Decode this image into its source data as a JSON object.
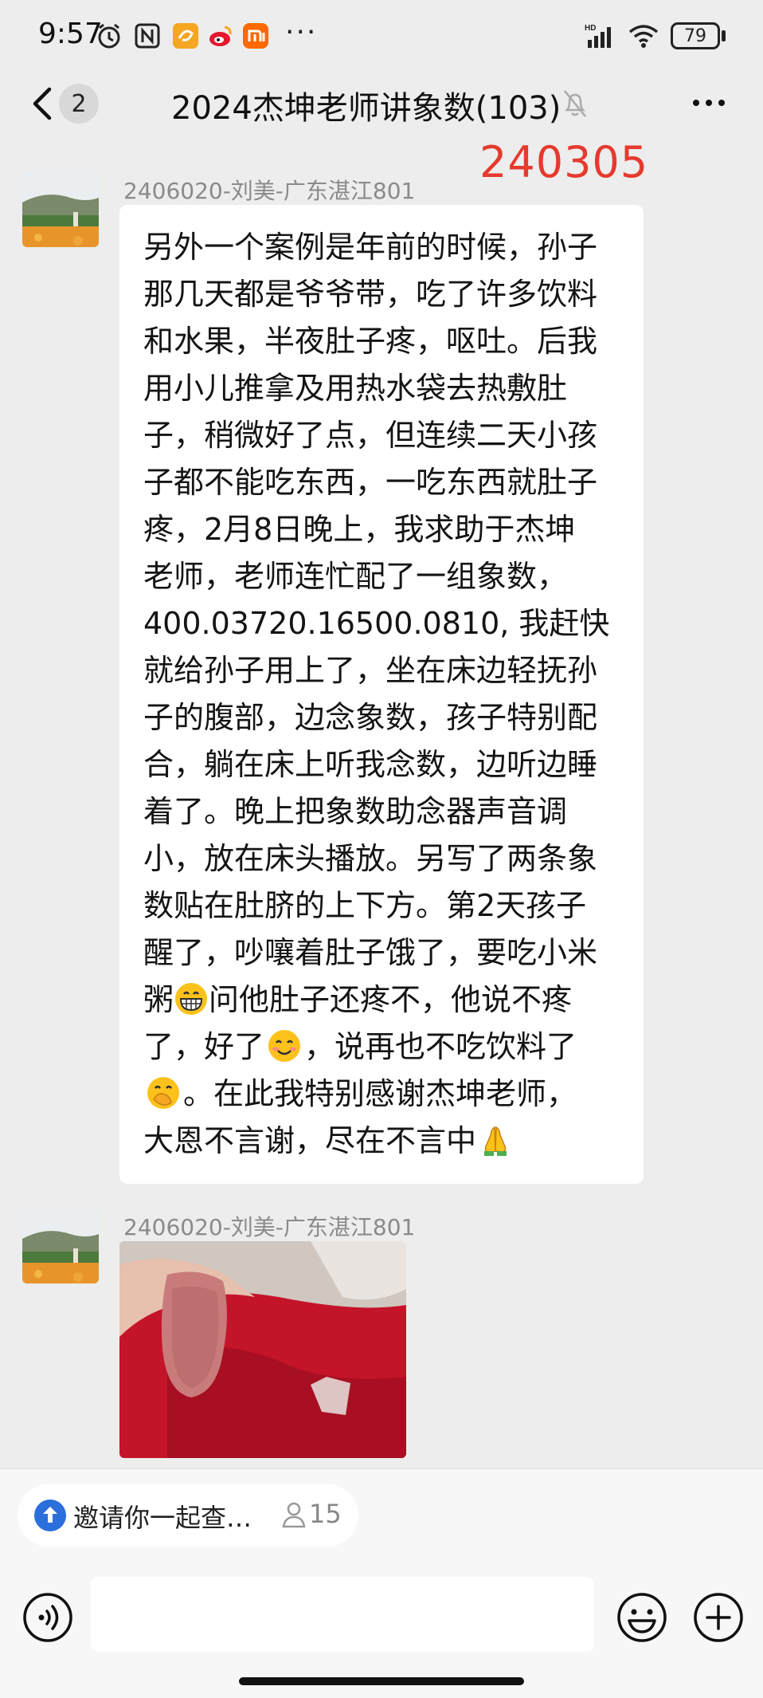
{
  "status_bar": {
    "time": "9:57",
    "network_label": "HD",
    "battery": "79",
    "more_dots": "···"
  },
  "header": {
    "back_count": "2",
    "title": "2024杰坤老师讲象数(103)"
  },
  "stamp_text": "240305",
  "messages": [
    {
      "sender": "2406020-刘美-广东湛江801",
      "lines": [
        "另外一个案例是年前的时候，孙子",
        "那几天都是爷爷带，吃了许多饮料",
        "和水果，半夜肚子疼，呕吐。后我",
        "用小儿推拿及用热水袋去热敷肚",
        "子，稍微好了点，但连续二天小孩",
        "子都不能吃东西，一吃东西就肚子",
        "疼，2月8日晚上，我求助于杰坤",
        "老师，老师连忙配了一组象数，",
        "400.03720.16500.0810, 我赶快",
        "就给孙子用上了，坐在床边轻抚孙",
        "子的腹部，边念象数，孩子特别配",
        "合，躺在床上听我念数，边听边睡",
        "着了。晚上把象数助念器声音调",
        "小，放在床头播放。另写了两条象",
        "数贴在肚脐的上下方。第2天孩子",
        "醒了，吵嚷着肚子饿了，要吃小米",
        "问他肚子还疼不，他说不疼",
        "了，好了",
        "，说再也不吃饮料了",
        "。在此我特别感谢杰坤老师，",
        "大恩不言谢，尽在不言中"
      ],
      "line16_prefix": "粥",
      "emojis": [
        "grinning-face",
        "smiling-face",
        "face-with-hand-over-mouth",
        "folded-hands"
      ]
    },
    {
      "sender": "2406020-刘美-广东湛江801",
      "image_desc_icon": "photo"
    }
  ],
  "invite": {
    "text": "邀请你一起查…",
    "count": "15"
  },
  "colors": {
    "background": "#ededed",
    "stamp": "#e63a2e",
    "bubble": "#ffffff"
  }
}
